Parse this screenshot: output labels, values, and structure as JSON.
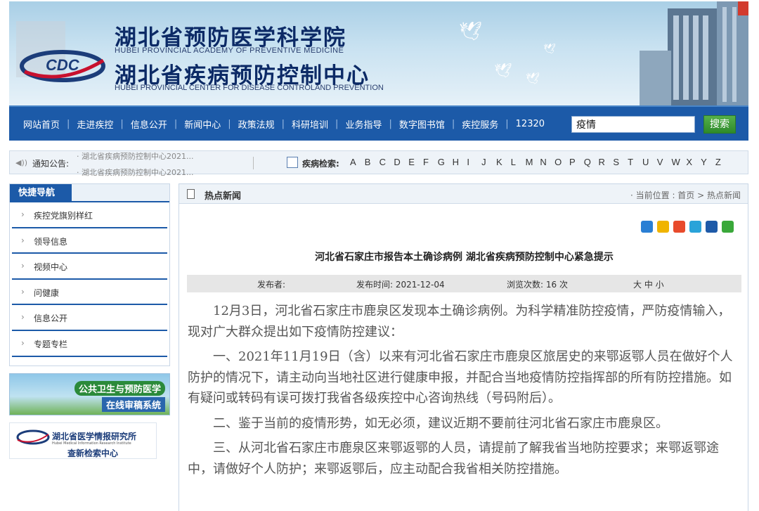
{
  "banner": {
    "title_cn_1": "湖北省预防医学科学院",
    "title_en_1": "HUBEI PROVINCIAL ACADEMY OF PREVENTIVE MEDICINE",
    "title_cn_2": "湖北省疾病预防控制中心",
    "title_en_2": "HUBEI PROVINCIAL CENTER FOR DISEASE CONTROLAND PREVENTION"
  },
  "nav": {
    "items": [
      "网站首页",
      "走进疾控",
      "信息公开",
      "新闻中心",
      "政策法规",
      "科研培训",
      "业务指导",
      "数字图书馆",
      "疾控服务",
      "12320"
    ],
    "search_value": "疫情",
    "search_button": "搜索"
  },
  "notice": {
    "label": "通知公告:",
    "items": [
      "· 湖北省疾病预防控制中心2021...",
      "· 湖北省疾病预防控制中心2021..."
    ]
  },
  "disease_search": {
    "label": "疾病检索:",
    "letters": [
      "A",
      "B",
      "C",
      "D",
      "E",
      "F",
      "G",
      "H",
      "I",
      "J",
      "K",
      "L",
      "M",
      "N",
      "O",
      "P",
      "Q",
      "R",
      "S",
      "T",
      "U",
      "V",
      "W",
      "X",
      "Y",
      "Z"
    ]
  },
  "sidebar": {
    "title": "快捷导航",
    "items": [
      "疾控党旗别样红",
      "领导信息",
      "视频中心",
      "问健康",
      "信息公开",
      "专题专栏"
    ]
  },
  "ads": {
    "banner1_line1": "公共卫生与预防医学",
    "banner1_line2": "在线审稿系统",
    "banner2_name": "湖北省医学情报研究所",
    "banner2_en": "Hubei Medical Information Research Institute",
    "banner2_sub": "查新检索中心"
  },
  "main": {
    "section_title": "热点新闻",
    "breadcrumb": "· 当前位置 : 首页 > 热点新闻",
    "article_title": "河北省石家庄市报告本土确诊病例 湖北省疾病预防控制中心紧急提示",
    "meta_publisher": "发布者:",
    "meta_time": "发布时间: 2021-12-04",
    "meta_views": "浏览次数: 16 次",
    "meta_font": "大 中 小",
    "paragraphs": [
      "12月3日，河北省石家庄市鹿泉区发现本土确诊病例。为科学精准防控疫情，严防疫情输入，现对广大群众提出如下疫情防控建议：",
      "一、2021年11月19日（含）以来有河北省石家庄市鹿泉区旅居史的来鄂返鄂人员在做好个人防护的情况下，请主动向当地社区进行健康申报，并配合当地疫情防控指挥部的所有防控措施。如有疑问或转码有误可拨打我省各级疾控中心咨询热线（号码附后）。",
      "二、鉴于当前的疫情形势，如无必须，建议近期不要前往河北省石家庄市鹿泉区。",
      "三、从河北省石家庄市鹿泉区来鄂返鄂的人员，请提前了解我省当地防控要求；来鄂返鄂途中，请做好个人防护；来鄂返鄂后，应主动配合我省相关防控措施。"
    ]
  },
  "colors": {
    "nav_blue": "#1c5aa8",
    "search_green": "#2e8a2a",
    "title_navy": "#0c2a66"
  }
}
